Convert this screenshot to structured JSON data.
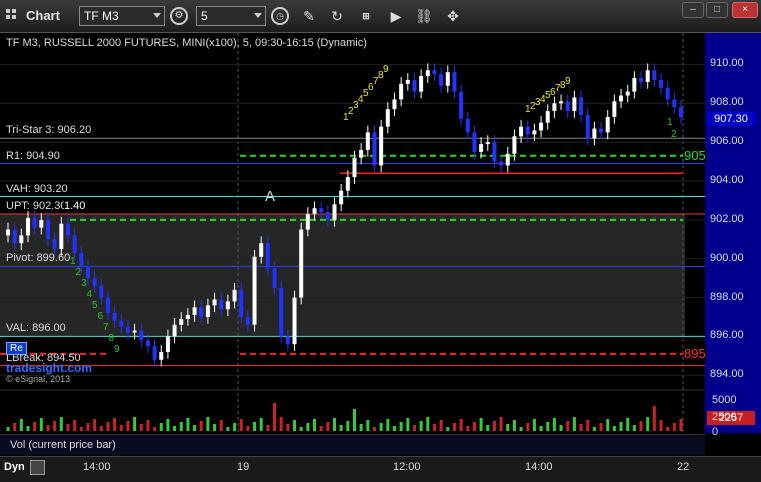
{
  "window": {
    "title": "Chart",
    "close": "×",
    "minimize": "–",
    "maximize": "□"
  },
  "toolbar": {
    "symbol": "TF M3",
    "interval": "5"
  },
  "chart": {
    "header": "TF M3, RUSSELL 2000 FUTURES, MINI(x100), 5, 09:30-16:15 (Dynamic)",
    "watermark": "tradesight.com",
    "copyright": "© eSignal, 2013",
    "annotation_a": "A",
    "levels": [
      {
        "label": "Tri-Star 3: 906.20",
        "price": 906.2,
        "color": "#888888",
        "style": "solid"
      },
      {
        "label": "R1: 904.90",
        "price": 904.9,
        "color": "#2a3cff",
        "style": "solid"
      },
      {
        "label": "VAH: 903.20",
        "price": 903.2,
        "color": "#40e0d0",
        "style": "solid"
      },
      {
        "label": "UPT: 902.30",
        "price": 902.3,
        "color": "#ff3030",
        "style": "solid"
      },
      {
        "label": "Pivot: 899.60",
        "price": 899.6,
        "color": "#2a3cff",
        "style": "solid"
      },
      {
        "label": "VAL: 896.00",
        "price": 896.0,
        "color": "#40e0d0",
        "style": "solid"
      },
      {
        "label": "LBreak: 894.50",
        "price": 894.5,
        "color": "#ff3030",
        "style": "solid"
      }
    ],
    "upt_extra": "1.40",
    "flag_label": "Re",
    "green_dashed_prices": [
      905.3,
      902.0
    ],
    "red_dashed_price": 895.1,
    "red_solid_price": 904.4,
    "line_tags": [
      {
        "text": "905",
        "price": 905.3,
        "color": "#22dd22"
      },
      {
        "text": "895",
        "price": 895.1,
        "color": "#ff3030"
      }
    ],
    "last_price_box": "907.30",
    "y_ticks": [
      "910.00",
      "908.00",
      "906.00",
      "904.00",
      "902.00",
      "900.00",
      "898.00",
      "896.00",
      "894.00"
    ],
    "volume_ticks": [
      "5000",
      "2500",
      "0"
    ],
    "volume_box": "2257",
    "volume_label": "Vol (current price bar)",
    "x_ticks": [
      "14:00",
      "19",
      "12:00",
      "14:00",
      "22"
    ],
    "dyn_label": "Dyn",
    "td_counts_yellow": [
      "1",
      "2",
      "3",
      "4",
      "5",
      "6",
      "7",
      "8",
      "9"
    ],
    "td_counts_yellow2": [
      "1",
      "2",
      "3",
      "4",
      "5",
      "6",
      "7",
      "8",
      "9"
    ],
    "td_counts_green_down": [
      "1",
      "2",
      "3",
      "4",
      "5",
      "6",
      "7",
      "8",
      "9"
    ],
    "td_counts_green_end": [
      "1",
      "2"
    ]
  },
  "colors": {
    "up_candle": "#ffffff",
    "down_candle": "#2233ff",
    "panel_bg": "#000000",
    "session_bg": "#262626",
    "axis_bg": "#00008c"
  }
}
